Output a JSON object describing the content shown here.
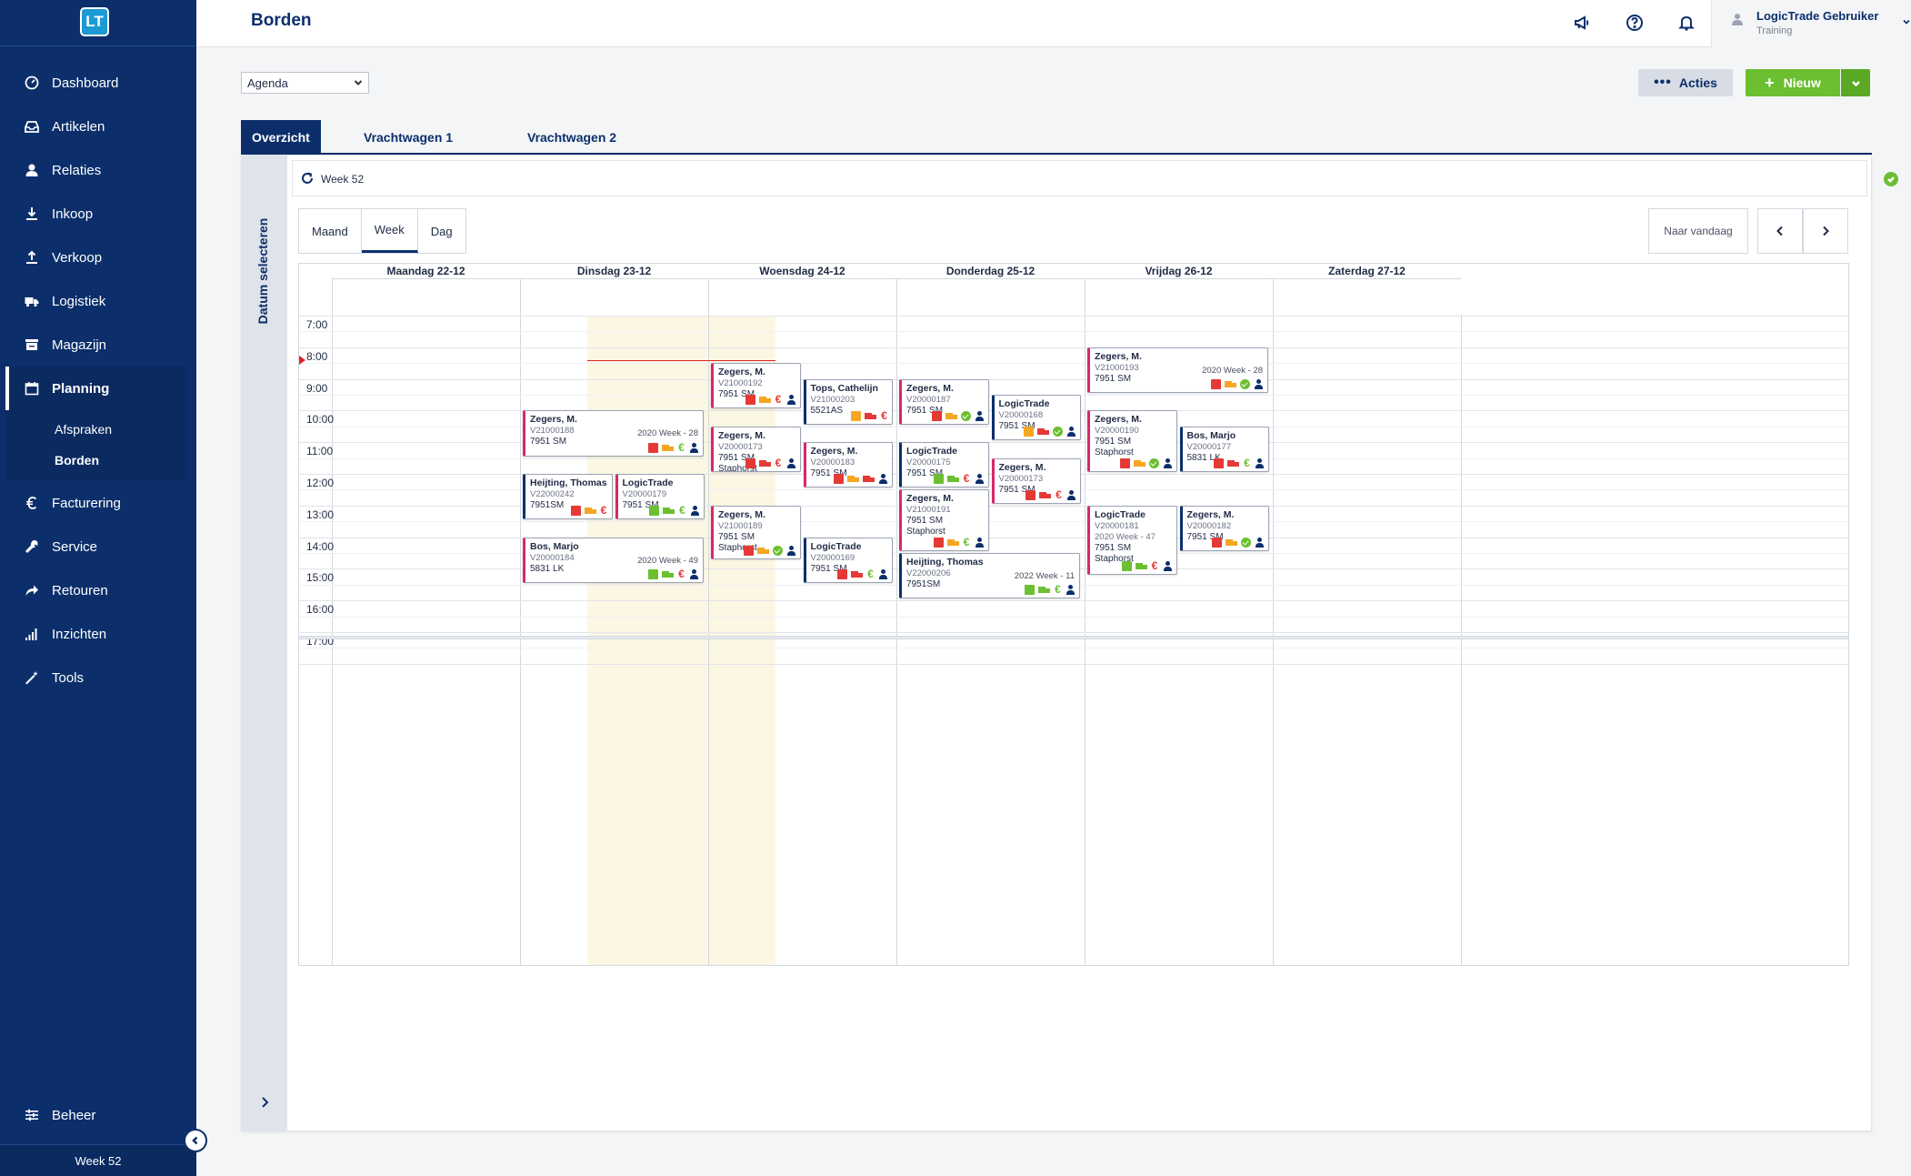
{
  "app": {
    "logo": "LT",
    "page_title": "Borden"
  },
  "sidebar": {
    "items": [
      {
        "key": "dashboard",
        "label": "Dashboard",
        "icon": "dashboard-icon"
      },
      {
        "key": "artikelen",
        "label": "Artikelen",
        "icon": "inbox-icon"
      },
      {
        "key": "relaties",
        "label": "Relaties",
        "icon": "user-icon"
      },
      {
        "key": "inkoop",
        "label": "Inkoop",
        "icon": "download-icon"
      },
      {
        "key": "verkoop",
        "label": "Verkoop",
        "icon": "upload-icon"
      },
      {
        "key": "logistiek",
        "label": "Logistiek",
        "icon": "truck-icon"
      },
      {
        "key": "magazijn",
        "label": "Magazijn",
        "icon": "warehouse-icon"
      },
      {
        "key": "planning",
        "label": "Planning",
        "icon": "calendar-icon",
        "active": true
      },
      {
        "key": "facturering",
        "label": "Facturering",
        "icon": "euro-icon"
      },
      {
        "key": "service",
        "label": "Service",
        "icon": "wrench-icon"
      },
      {
        "key": "retouren",
        "label": "Retouren",
        "icon": "return-arrow-icon"
      },
      {
        "key": "inzichten",
        "label": "Inzichten",
        "icon": "bar-chart-icon"
      },
      {
        "key": "tools",
        "label": "Tools",
        "icon": "magic-wand-icon"
      }
    ],
    "subitems": [
      {
        "label": "Afspraken",
        "active": false
      },
      {
        "label": "Borden",
        "active": true
      }
    ],
    "beheer": "Beheer",
    "footer_week": "Week 52"
  },
  "user": {
    "name": "LogicTrade Gebruiker",
    "sub": "Training"
  },
  "toolbar": {
    "view_select": "Agenda",
    "acties_label": "Acties",
    "nieuw_label": "Nieuw"
  },
  "tabs": [
    "Overzicht",
    "Vrachtwagen 1",
    "Vrachtwagen 2"
  ],
  "calendar": {
    "side_label": "Datum selecteren",
    "week_label": "Week 52",
    "views": [
      "Maand",
      "Week",
      "Dag"
    ],
    "active_view": "Week",
    "today_label": "Naar vandaag",
    "days": [
      "Maandag 22-12",
      "Dinsdag 23-12",
      "Woensdag 24-12",
      "Donderdag 25-12",
      "Vrijdag 26-12",
      "Zaterdag 27-12"
    ],
    "times": [
      "7:00",
      "8:00",
      "9:00",
      "10:00",
      "11:00",
      "12:00",
      "13:00",
      "14:00",
      "15:00",
      "16:00",
      "17:00"
    ],
    "colors": {
      "red": "#e53935",
      "green": "#6bbf30",
      "orange": "#f5a623",
      "navy": "#0c2f6b",
      "pink": "#d6286b"
    }
  },
  "events": [
    {
      "day": 1,
      "col": 0,
      "span": 2,
      "start": 10.0,
      "end": 11.5,
      "accent": "pink",
      "name": "Zegers, M.",
      "code": "V21000188",
      "addr": "7951 SM",
      "week": "2020 Week - 28",
      "icons": [
        "box-red",
        "truck-orange",
        "euro-green",
        "user"
      ]
    },
    {
      "day": 1,
      "col": 0,
      "span": 1,
      "start": 12.0,
      "end": 13.5,
      "accent": "navy",
      "name": "Heijting, Thomas",
      "code": "V22000242",
      "addr": "7951SM",
      "icons": [
        "box-red",
        "truck-orange",
        "euro-red"
      ]
    },
    {
      "day": 1,
      "col": 1,
      "span": 1,
      "start": 12.0,
      "end": 13.5,
      "accent": "pink",
      "name": "LogicTrade",
      "code": "V20000179",
      "addr": "7951 SM",
      "icons": [
        "box-green",
        "truck-green",
        "euro-green",
        "user"
      ]
    },
    {
      "day": 1,
      "col": 0,
      "span": 2,
      "start": 14.0,
      "end": 15.5,
      "accent": "pink",
      "name": "Bos, Marjo",
      "code": "V20000184",
      "addr": "5831 LK",
      "week": "2020 Week - 49",
      "icons": [
        "box-green",
        "truck-green",
        "euro-red",
        "user"
      ]
    },
    {
      "day": 2,
      "col": 0,
      "span": 1,
      "start": 8.5,
      "end": 10.0,
      "accent": "pink",
      "name": "Zegers, M.",
      "code": "V21000192",
      "addr": "7951 SM",
      "icons": [
        "box-red",
        "truck-orange",
        "euro-red",
        "user"
      ]
    },
    {
      "day": 2,
      "col": 1,
      "span": 1,
      "start": 9.0,
      "end": 10.5,
      "accent": "navy",
      "name": "Tops, Cathelijn",
      "code": "V21000203",
      "addr": "5521AS",
      "icons": [
        "box-orange",
        "truck-red",
        "euro-red"
      ]
    },
    {
      "day": 2,
      "col": 0,
      "span": 1,
      "start": 10.5,
      "end": 12.0,
      "accent": "pink",
      "name": "Zegers, M.",
      "code": "V20000173",
      "addr": "7951 SM",
      "addr2": "Staphorst",
      "icons": [
        "box-red",
        "truck-red",
        "euro-red",
        "user"
      ]
    },
    {
      "day": 2,
      "col": 1,
      "span": 1,
      "start": 11.0,
      "end": 12.5,
      "accent": "pink",
      "name": "Zegers, M.",
      "code": "V20000183",
      "addr": "7951 SM",
      "icons": [
        "box-red",
        "truck-orange",
        "truck-red",
        "user"
      ]
    },
    {
      "day": 2,
      "col": 0,
      "span": 1,
      "start": 13.0,
      "end": 14.75,
      "accent": "pink",
      "name": "Zegers, M.",
      "code": "V21000189",
      "addr": "7951 SM",
      "addr2": "Staphorst",
      "icons": [
        "box-red",
        "truck-orange",
        "ok",
        "user"
      ]
    },
    {
      "day": 2,
      "col": 1,
      "span": 1,
      "start": 14.0,
      "end": 15.5,
      "accent": "navy",
      "name": "LogicTrade",
      "code": "V20000169",
      "addr": "7951 SM",
      "icons": [
        "box-red",
        "truck-red",
        "euro-green",
        "user"
      ]
    },
    {
      "day": 3,
      "col": 0,
      "span": 1,
      "start": 9.0,
      "end": 10.5,
      "accent": "pink",
      "name": "Zegers, M.",
      "code": "V20000187",
      "addr": "7951 SM",
      "icons": [
        "box-red",
        "truck-orange",
        "ok",
        "user"
      ]
    },
    {
      "day": 3,
      "col": 1,
      "span": 1,
      "start": 9.5,
      "end": 11.0,
      "accent": "navy",
      "name": "LogicTrade",
      "code": "V20000168",
      "addr": "7951 SM",
      "icons": [
        "box-orange",
        "truck-red",
        "ok",
        "user"
      ]
    },
    {
      "day": 3,
      "col": 0,
      "span": 1,
      "start": 11.0,
      "end": 12.5,
      "accent": "navy",
      "name": "LogicTrade",
      "code": "V20000175",
      "addr": "7951 SM",
      "icons": [
        "box-green",
        "truck-green",
        "euro-red",
        "user"
      ]
    },
    {
      "day": 3,
      "col": 1,
      "span": 1,
      "start": 11.5,
      "end": 13.0,
      "accent": "pink",
      "name": "Zegers, M.",
      "code": "V20000173",
      "addr": "7951 SM",
      "icons": [
        "box-red",
        "truck-red",
        "euro-red",
        "user"
      ]
    },
    {
      "day": 3,
      "col": 0,
      "span": 1,
      "start": 12.5,
      "end": 14.5,
      "accent": "pink",
      "name": "Zegers, M.",
      "code": "V21000191",
      "addr": "7951 SM",
      "addr2": "Staphorst",
      "icons": [
        "box-red",
        "truck-orange",
        "euro-green",
        "user"
      ]
    },
    {
      "day": 3,
      "col": 0,
      "span": 2,
      "start": 14.5,
      "end": 16.0,
      "accent": "navy",
      "name": "Heijting, Thomas",
      "code": "V22000206",
      "addr": "7951SM",
      "week": "2022 Week - 11",
      "icons": [
        "box-green",
        "truck-green",
        "euro-green",
        "user"
      ]
    },
    {
      "day": 4,
      "col": 0,
      "span": 2,
      "start": 8.0,
      "end": 9.5,
      "accent": "pink",
      "name": "Zegers, M.",
      "code": "V21000193",
      "addr": "7951 SM",
      "week": "2020 Week - 28",
      "icons": [
        "box-red",
        "truck-orange",
        "ok",
        "user"
      ]
    },
    {
      "day": 4,
      "col": 0,
      "span": 1,
      "start": 10.0,
      "end": 12.0,
      "accent": "pink",
      "name": "Zegers, M.",
      "code": "V20000190",
      "addr": "7951 SM",
      "addr2": "Staphorst",
      "icons": [
        "box-red",
        "truck-orange",
        "ok",
        "user"
      ]
    },
    {
      "day": 4,
      "col": 1,
      "span": 1,
      "start": 10.5,
      "end": 12.0,
      "accent": "navy",
      "name": "Bos, Marjo",
      "code": "V20000177",
      "addr": "5831 LK",
      "icons": [
        "box-red",
        "truck-red",
        "euro-green",
        "user"
      ]
    },
    {
      "day": 4,
      "col": 0,
      "span": 1,
      "start": 13.0,
      "end": 15.25,
      "accent": "pink",
      "name": "LogicTrade",
      "code": "V20000181",
      "week_line": "2020 Week - 47",
      "addr": "7951 SM",
      "addr2": "Staphorst",
      "icons": [
        "box-green",
        "truck-green",
        "euro-red",
        "user"
      ]
    },
    {
      "day": 4,
      "col": 1,
      "span": 1,
      "start": 13.0,
      "end": 14.5,
      "accent": "navy",
      "name": "Zegers, M.",
      "code": "V20000182",
      "addr": "7951 SM",
      "icons": [
        "box-red",
        "truck-orange",
        "ok",
        "user"
      ]
    }
  ]
}
